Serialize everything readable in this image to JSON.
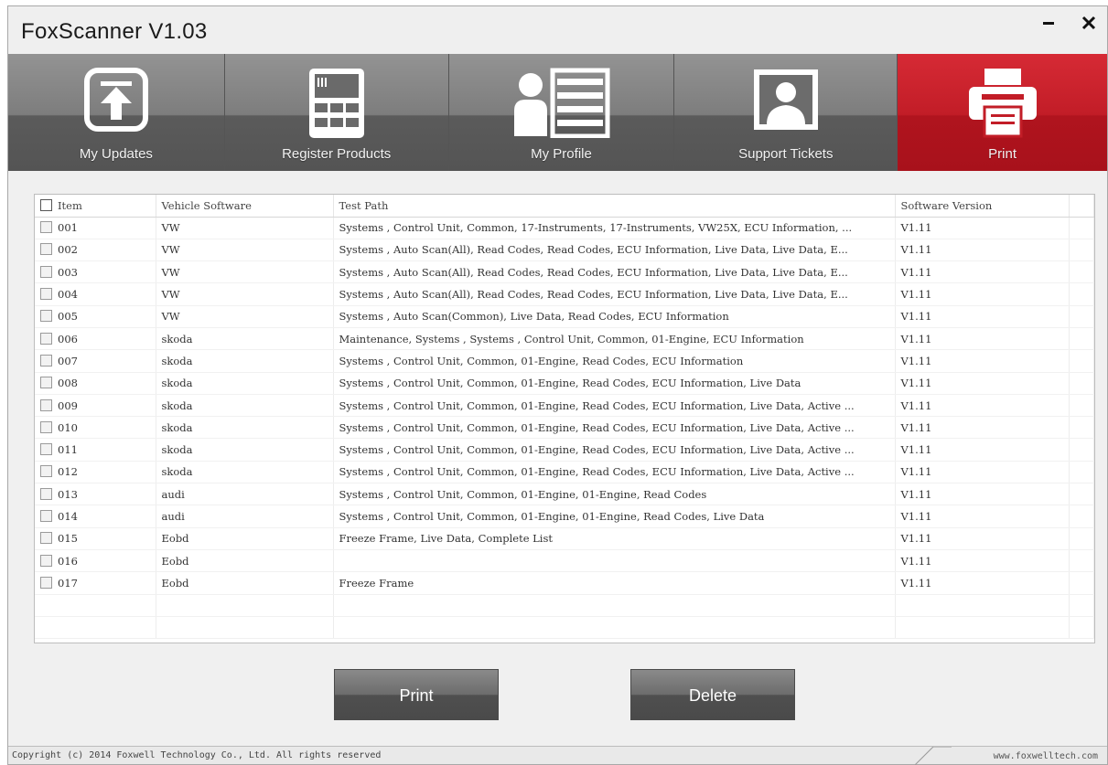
{
  "window": {
    "title": "FoxScanner  V1.03",
    "minimize_label": "‒",
    "close_label": "✖"
  },
  "tabs": [
    {
      "label": "My Updates",
      "icon": "upload-icon",
      "active": false
    },
    {
      "label": "Register Products",
      "icon": "register-device-icon",
      "active": false
    },
    {
      "label": "My Profile",
      "icon": "profile-list-icon",
      "active": false
    },
    {
      "label": "Support Tickets",
      "icon": "support-person-icon",
      "active": false
    },
    {
      "label": "Print",
      "icon": "printer-icon",
      "active": true
    }
  ],
  "table": {
    "headers": {
      "item": "Item",
      "vehicle": "Vehicle Software",
      "path": "Test Path",
      "version": "Software Version"
    },
    "rows": [
      {
        "item": "001",
        "vehicle": "VW",
        "path": "Systems , Control Unit, Common, 17-Instruments, 17-Instruments, VW25X, ECU Information, ...",
        "version": "V1.11"
      },
      {
        "item": "002",
        "vehicle": "VW",
        "path": "Systems , Auto Scan(All), Read Codes, Read Codes, ECU Information, Live Data, Live Data, E...",
        "version": "V1.11"
      },
      {
        "item": "003",
        "vehicle": "VW",
        "path": "Systems , Auto Scan(All), Read Codes, Read Codes, ECU Information, Live Data, Live Data, E...",
        "version": "V1.11"
      },
      {
        "item": "004",
        "vehicle": "VW",
        "path": "Systems , Auto Scan(All), Read Codes, Read Codes, ECU Information, Live Data, Live Data, E...",
        "version": "V1.11"
      },
      {
        "item": "005",
        "vehicle": "VW",
        "path": "Systems , Auto Scan(Common), Live Data, Read Codes, ECU Information",
        "version": "V1.11"
      },
      {
        "item": "006",
        "vehicle": "skoda",
        "path": "Maintenance, Systems , Systems , Control Unit, Common, 01-Engine, ECU Information",
        "version": "V1.11"
      },
      {
        "item": "007",
        "vehicle": "skoda",
        "path": "Systems , Control Unit, Common, 01-Engine, Read Codes, ECU Information",
        "version": "V1.11"
      },
      {
        "item": "008",
        "vehicle": "skoda",
        "path": "Systems , Control Unit, Common, 01-Engine, Read Codes, ECU Information, Live Data",
        "version": "V1.11"
      },
      {
        "item": "009",
        "vehicle": "skoda",
        "path": "Systems , Control Unit, Common, 01-Engine, Read Codes, ECU Information, Live Data, Active ...",
        "version": "V1.11"
      },
      {
        "item": "010",
        "vehicle": "skoda",
        "path": "Systems , Control Unit, Common, 01-Engine, Read Codes, ECU Information, Live Data, Active ...",
        "version": "V1.11"
      },
      {
        "item": "011",
        "vehicle": "skoda",
        "path": "Systems , Control Unit, Common, 01-Engine, Read Codes, ECU Information, Live Data, Active ...",
        "version": "V1.11"
      },
      {
        "item": "012",
        "vehicle": "skoda",
        "path": "Systems , Control Unit, Common, 01-Engine, Read Codes, ECU Information, Live Data, Active ...",
        "version": "V1.11"
      },
      {
        "item": "013",
        "vehicle": "audi",
        "path": "Systems , Control Unit, Common, 01-Engine, 01-Engine, Read Codes",
        "version": "V1.11"
      },
      {
        "item": "014",
        "vehicle": "audi",
        "path": "Systems , Control Unit, Common, 01-Engine, 01-Engine, Read Codes, Live Data",
        "version": "V1.11"
      },
      {
        "item": "015",
        "vehicle": "Eobd",
        "path": "Freeze Frame, Live Data, Complete List",
        "version": "V1.11"
      },
      {
        "item": "016",
        "vehicle": "Eobd",
        "path": "",
        "version": "V1.11"
      },
      {
        "item": "017",
        "vehicle": "Eobd",
        "path": "Freeze Frame",
        "version": "V1.11"
      }
    ]
  },
  "buttons": {
    "print": "Print",
    "delete": "Delete"
  },
  "status": {
    "copyright": "Copyright (c) 2014 Foxwell Technology Co., Ltd. All rights reserved",
    "website": "www.foxwelltech.com"
  },
  "colors": {
    "accent": "#c21d27",
    "tab_gray": "#7d7d7d"
  }
}
